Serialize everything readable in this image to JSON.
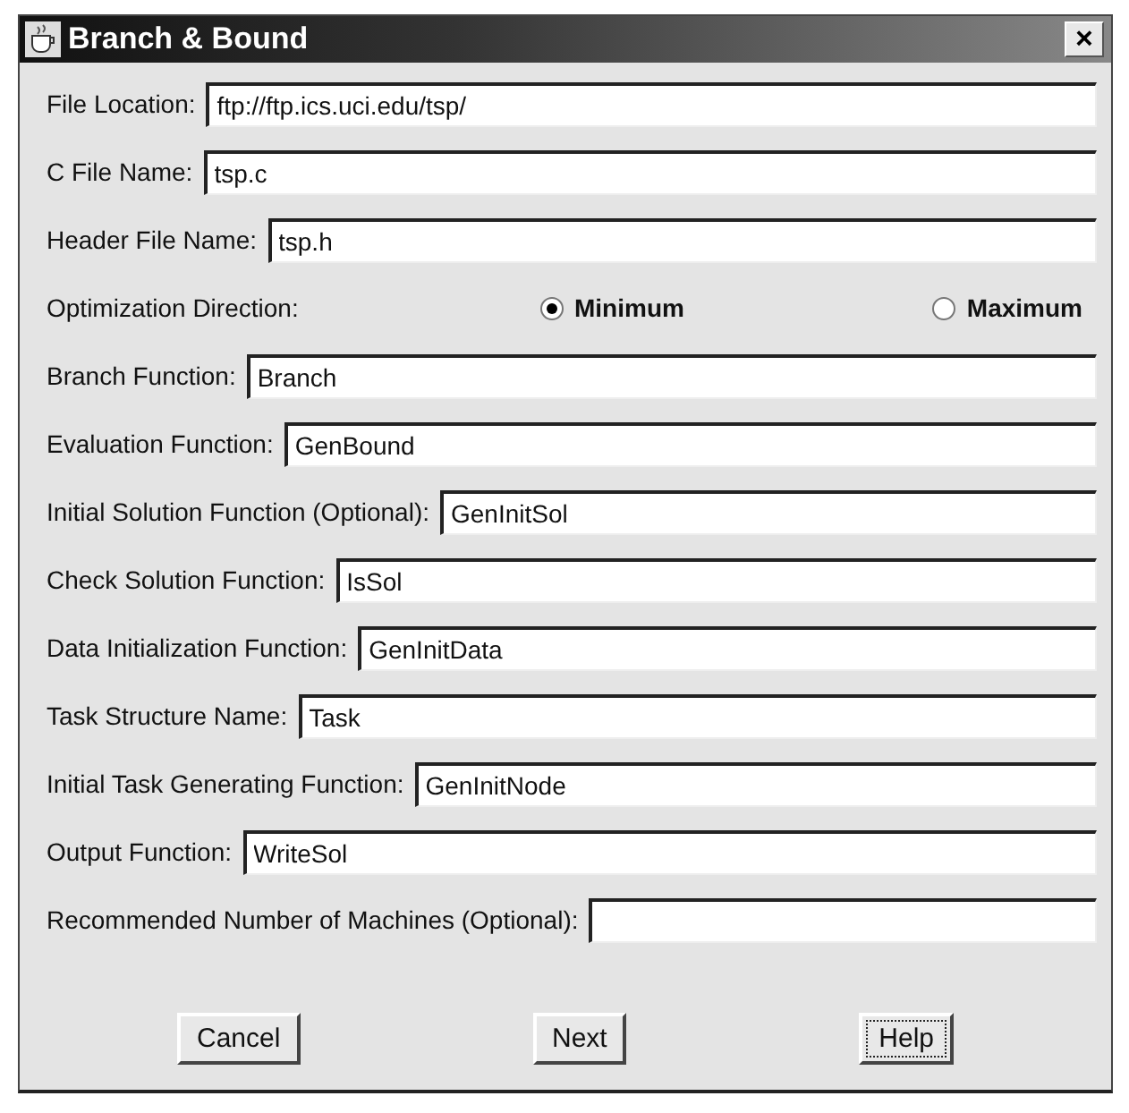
{
  "window": {
    "title": "Branch & Bound",
    "close": "×"
  },
  "rows": [
    {
      "kind": "field",
      "label": "File Location:",
      "value": "ftp://ftp.ics.uci.edu/tsp/"
    },
    {
      "kind": "field",
      "label": "C File Name:",
      "value": "tsp.c"
    },
    {
      "kind": "field",
      "label": "Header File Name:",
      "value": "tsp.h"
    },
    {
      "kind": "radio",
      "label": "Optimization Direction:",
      "options": [
        {
          "label": "Minimum",
          "selected": true
        },
        {
          "label": "Maximum",
          "selected": false
        }
      ]
    },
    {
      "kind": "field",
      "label": "Branch Function:",
      "value": "Branch"
    },
    {
      "kind": "field",
      "label": "Evaluation Function:",
      "value": "GenBound"
    },
    {
      "kind": "field",
      "label": "Initial Solution Function (Optional):",
      "value": "GenInitSol"
    },
    {
      "kind": "field",
      "label": "Check Solution Function:",
      "value": "IsSol"
    },
    {
      "kind": "field",
      "label": "Data Initialization Function:",
      "value": "GenInitData"
    },
    {
      "kind": "field",
      "label": "Task Structure Name:",
      "value": "Task"
    },
    {
      "kind": "field",
      "label": "Initial Task Generating Function:",
      "value": "GenInitNode"
    },
    {
      "kind": "field",
      "label": "Output Function:",
      "value": "WriteSol"
    },
    {
      "kind": "field",
      "label": "Recommended Number of Machines (Optional):"
    }
  ],
  "buttons": [
    {
      "label": "Cancel",
      "focused": false
    },
    {
      "label": "Next",
      "focused": false
    },
    {
      "label": "Help",
      "focused": true
    }
  ]
}
